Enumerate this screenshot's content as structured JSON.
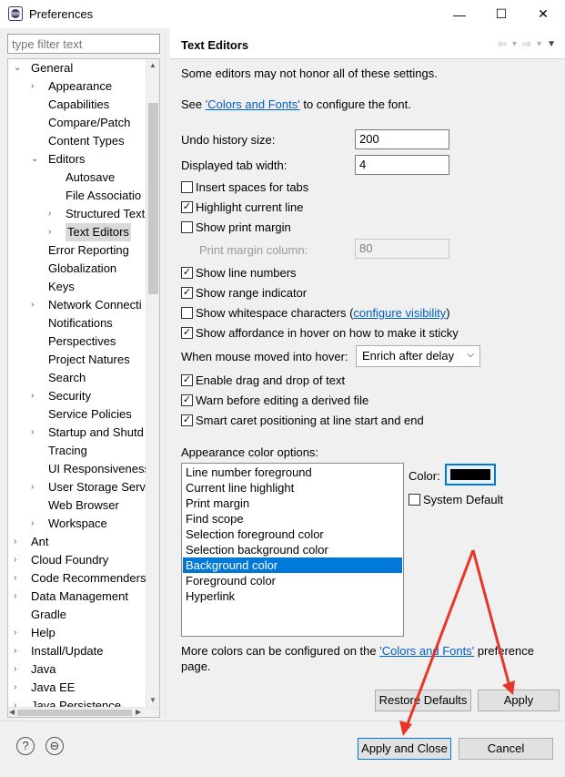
{
  "window": {
    "title": "Preferences",
    "minimize_glyph": "—",
    "maximize_glyph": "☐",
    "close_glyph": "✕"
  },
  "sidebar": {
    "filter_placeholder": "type filter text",
    "tree": [
      {
        "label": "General",
        "twisty": "⌄"
      },
      {
        "label": "Appearance",
        "twisty": "›"
      },
      {
        "label": "Capabilities",
        "twisty": ""
      },
      {
        "label": "Compare/Patch",
        "twisty": ""
      },
      {
        "label": "Content Types",
        "twisty": ""
      },
      {
        "label": "Editors",
        "twisty": "⌄"
      },
      {
        "label": "Autosave",
        "twisty": ""
      },
      {
        "label": "File Associatio",
        "twisty": ""
      },
      {
        "label": "Structured Text",
        "twisty": "›"
      },
      {
        "label": "Text Editors",
        "twisty": "›"
      },
      {
        "label": "Error Reporting",
        "twisty": ""
      },
      {
        "label": "Globalization",
        "twisty": ""
      },
      {
        "label": "Keys",
        "twisty": ""
      },
      {
        "label": "Network Connecti",
        "twisty": "›"
      },
      {
        "label": "Notifications",
        "twisty": ""
      },
      {
        "label": "Perspectives",
        "twisty": ""
      },
      {
        "label": "Project Natures",
        "twisty": ""
      },
      {
        "label": "Search",
        "twisty": ""
      },
      {
        "label": "Security",
        "twisty": "›"
      },
      {
        "label": "Service Policies",
        "twisty": ""
      },
      {
        "label": "Startup and Shutd",
        "twisty": "›"
      },
      {
        "label": "Tracing",
        "twisty": ""
      },
      {
        "label": "UI Responsiveness",
        "twisty": ""
      },
      {
        "label": "User Storage Serv",
        "twisty": "›"
      },
      {
        "label": "Web Browser",
        "twisty": ""
      },
      {
        "label": "Workspace",
        "twisty": "›"
      },
      {
        "label": "Ant",
        "twisty": "›"
      },
      {
        "label": "Cloud Foundry",
        "twisty": "›"
      },
      {
        "label": "Code Recommenders",
        "twisty": "›"
      },
      {
        "label": "Data Management",
        "twisty": "›"
      },
      {
        "label": "Gradle",
        "twisty": ""
      },
      {
        "label": "Help",
        "twisty": "›"
      },
      {
        "label": "Install/Update",
        "twisty": "›"
      },
      {
        "label": "Java",
        "twisty": "›"
      },
      {
        "label": "Java EE",
        "twisty": "›"
      },
      {
        "label": "Java Persistence",
        "twisty": "›"
      }
    ]
  },
  "page": {
    "title": "Text Editors",
    "nav": {
      "back": "⇦",
      "forward": "⇨",
      "dropdown": "▾",
      "menu": "▼"
    },
    "note": "Some editors may not honor all of these settings.",
    "see_prefix": "See ",
    "colors_fonts_link": "'Colors and Fonts'",
    "see_suffix": " to configure the font.",
    "undo_label": "Undo history size:",
    "undo_value": "200",
    "tab_width_label": "Displayed tab width:",
    "tab_width_value": "4",
    "insert_spaces": "Insert spaces for tabs",
    "highlight_line": "Highlight current line",
    "show_print_margin": "Show print margin",
    "print_margin_column_label": "Print margin column:",
    "print_margin_column_value": "80",
    "show_line_numbers": "Show line numbers",
    "show_range_indicator": "Show range indicator",
    "show_whitespace_prefix": "Show whitespace characters (",
    "configure_visibility_link": "configure visibility",
    "show_whitespace_suffix": ")",
    "show_affordance": "Show affordance in hover on how to make it sticky",
    "hover_label": "When mouse moved into hover:",
    "hover_value": "Enrich after delay",
    "enable_dnd": "Enable drag and drop of text",
    "warn_derived": "Warn before editing a derived file",
    "smart_caret": "Smart caret positioning at line start and end",
    "checked_mark": "✓",
    "appearance_label": "Appearance color options:",
    "color_options": [
      "Line number foreground",
      "Current line highlight",
      "Print margin",
      "Find scope",
      "Selection foreground color",
      "Selection background color",
      "Background color",
      "Foreground color",
      "Hyperlink"
    ],
    "color_label": "Color:",
    "system_default": "System Default",
    "more_colors_prefix": "More colors can be configured on the ",
    "more_colors_link": "'Colors and Fonts'",
    "more_colors_suffix": " preference",
    "more_colors_line2": "page.",
    "restore_defaults": "Restore Defaults",
    "apply": "Apply"
  },
  "footer": {
    "help_glyph": "?",
    "import_glyph": "⊖",
    "apply_and_close": "Apply and Close",
    "cancel": "Cancel"
  },
  "colors": {
    "accent": "#0078d7",
    "link": "#0060c0",
    "arrow": "#e8352a",
    "selected_swatch": "#000000"
  }
}
